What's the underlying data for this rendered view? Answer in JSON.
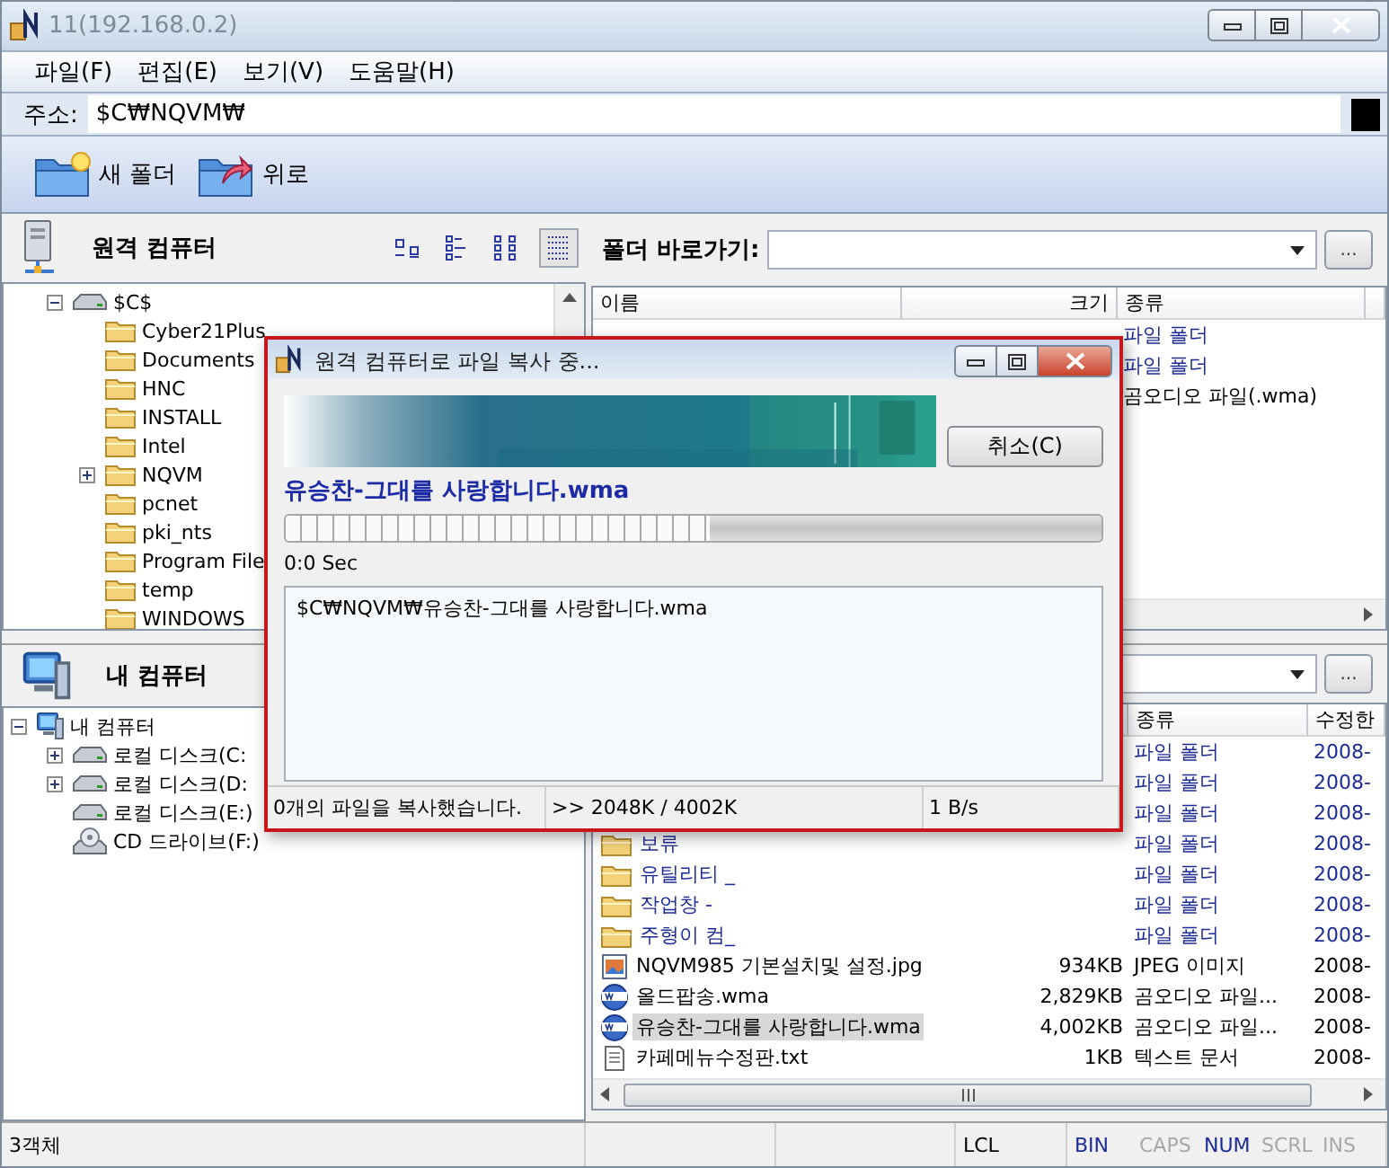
{
  "window": {
    "title": "11(192.168.0.2)"
  },
  "menu": [
    {
      "label": "파일(F)"
    },
    {
      "label": "편집(E)"
    },
    {
      "label": "보기(V)"
    },
    {
      "label": "도움말(H)"
    }
  ],
  "address": {
    "label": "주소:",
    "value": "$C₩NQVM₩"
  },
  "toolbar": [
    {
      "label": "새 폴더",
      "kind": "new-folder"
    },
    {
      "label": "위로",
      "kind": "up"
    }
  ],
  "remote_panel": {
    "title": "원격 컴퓨터",
    "views": [
      {
        "kind": "large",
        "selected": false
      },
      {
        "kind": "small",
        "selected": false
      },
      {
        "kind": "list",
        "selected": false
      },
      {
        "kind": "details",
        "selected": true
      }
    ],
    "tree": [
      {
        "label": "$C$",
        "kind": "drive",
        "expanded": true,
        "children": [
          {
            "label": "Cyber21Plus",
            "kind": "folder"
          },
          {
            "label": "Documents",
            "kind": "folder"
          },
          {
            "label": "HNC",
            "kind": "folder"
          },
          {
            "label": "INSTALL",
            "kind": "folder"
          },
          {
            "label": "Intel",
            "kind": "folder"
          },
          {
            "label": "NQVM",
            "kind": "folder",
            "expanded": false
          },
          {
            "label": "pcnet",
            "kind": "folder"
          },
          {
            "label": "pki_nts",
            "kind": "folder"
          },
          {
            "label": "Program File",
            "kind": "folder"
          },
          {
            "label": "temp",
            "kind": "folder"
          },
          {
            "label": "WINDOWS",
            "kind": "folder"
          }
        ]
      }
    ]
  },
  "local_panel": {
    "title": "내 컴퓨터",
    "tree": [
      {
        "label": "내 컴퓨터",
        "kind": "computer",
        "expanded": true,
        "children": [
          {
            "label": "로컬 디스크(C:",
            "kind": "drive",
            "expanded": false
          },
          {
            "label": "로컬 디스크(D:",
            "kind": "drive",
            "expanded": false
          },
          {
            "label": "로컬 디스크(E:)",
            "kind": "drive"
          },
          {
            "label": "CD 드라이브(F:)",
            "kind": "cd"
          }
        ]
      }
    ]
  },
  "remote_list": {
    "shortcut_label": "폴더 바로가기:",
    "browse": "...",
    "columns": [
      "이름",
      "크기",
      "종류"
    ],
    "rows": [
      {
        "kind": "folder",
        "type": "파일 폴더"
      },
      {
        "kind": "folder",
        "type": "파일 폴더"
      },
      {
        "kind": "wma",
        "type": "곰오디오 파일(.wma)"
      }
    ]
  },
  "local_list": {
    "browse": "...",
    "columns": [
      "종류",
      "수정한"
    ],
    "rows": [
      {
        "kind": "folder",
        "type": "파일 폴더",
        "date": "2008-"
      },
      {
        "kind": "folder",
        "type": "파일 폴더",
        "date": "2008-"
      },
      {
        "kind": "folder",
        "type": "파일 폴더",
        "date": "2008-"
      },
      {
        "kind": "folder",
        "name": "보류",
        "type": "파일 폴더",
        "date": "2008-",
        "selected": false
      },
      {
        "kind": "folder",
        "name": "유틸리티 _",
        "type": "파일 폴더",
        "date": "2008-",
        "selected": false
      },
      {
        "kind": "folder",
        "name": "작업창   -",
        "type": "파일 폴더",
        "date": "2008-",
        "selected": false
      },
      {
        "kind": "folder",
        "name": "주형이 컴_",
        "type": "파일 폴더",
        "date": "2008-",
        "selected": false
      },
      {
        "kind": "jpg",
        "name": "NQVM985 기본설치및 설정.jpg",
        "size": "934KB",
        "type": "JPEG 이미지",
        "date": "2008-",
        "selected": false
      },
      {
        "kind": "wma",
        "name": "올드팝송.wma",
        "size": "2,829KB",
        "type": "곰오디오 파일...",
        "date": "2008-",
        "selected": false
      },
      {
        "kind": "wma",
        "name": "유승찬-그대를 사랑합니다.wma",
        "size": "4,002KB",
        "type": "곰오디오 파일...",
        "date": "2008-",
        "selected": true
      },
      {
        "kind": "txt",
        "name": "카페메뉴수정판.txt",
        "size": "1KB",
        "type": "텍스트 문서",
        "date": "2008-",
        "selected": false
      }
    ]
  },
  "dialog": {
    "title": "원격 컴퓨터로 파일 복사 중...",
    "cancel": "취소(C)",
    "file": "유승찬-그대를 사랑합니다.wma",
    "level": 0.52,
    "elapsed": "0:0 Sec",
    "log": [
      "$C₩NQVM₩유승찬-그대를 사랑합니다.wma"
    ],
    "status": [
      "0개의 파일을 복사했습니다.",
      ">> 2048K / 4002K",
      "1 B/s"
    ]
  },
  "status_bar": {
    "text": "3객체",
    "mode": "LCL",
    "indicators": [
      {
        "label": "BIN",
        "on": true
      },
      {
        "label": "CAPS",
        "on": false
      },
      {
        "label": "NUM",
        "on": true
      },
      {
        "label": "SCRL",
        "on": false
      },
      {
        "label": "INS",
        "on": false
      }
    ]
  }
}
